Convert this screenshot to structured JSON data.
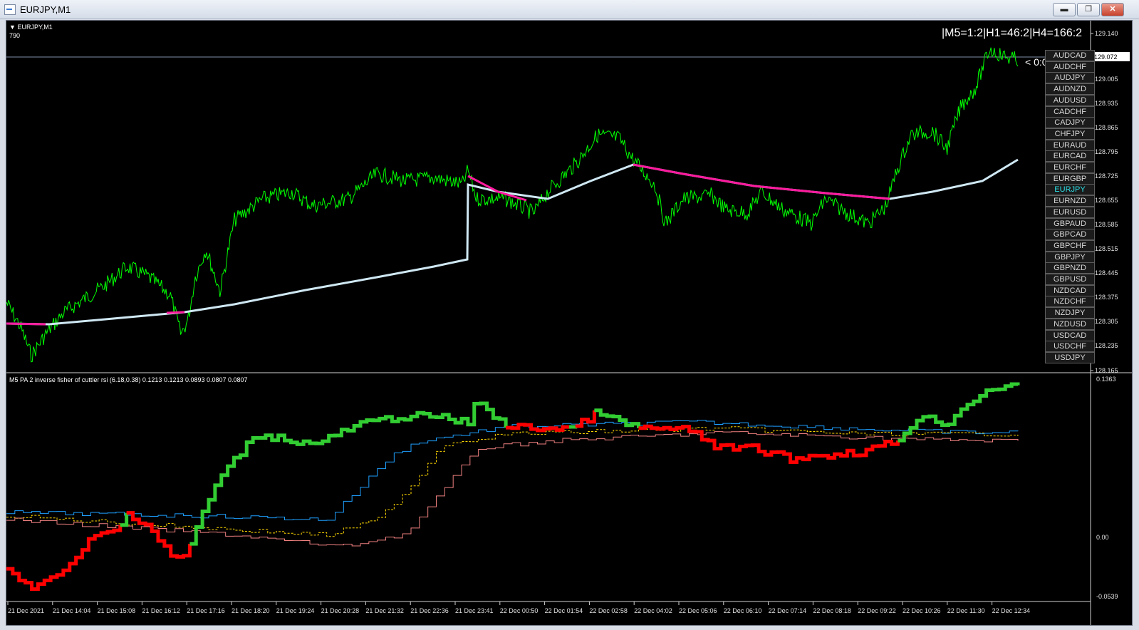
{
  "window": {
    "title": "EURJPY,M1",
    "minimize_glyph": "▬",
    "restore_glyph": "❐",
    "close_glyph": "✕"
  },
  "chart": {
    "symbol_label": "EURJPY,M1",
    "sub_label": "790",
    "status_text": "|M5=1:2|H1=46:2|H4=166:2",
    "marker_text": "< 0:02",
    "current_price": "129.072",
    "price_ticks": [
      "129.140",
      "129.005",
      "128.935",
      "128.865",
      "128.795",
      "128.725",
      "128.655",
      "128.585",
      "128.515",
      "128.445",
      "128.375",
      "128.305",
      "128.235",
      "128.165"
    ],
    "price_color": "#00ff00",
    "ma_color_up": "#cfe8f3",
    "ma_color_down": "#ff1a9e"
  },
  "indicator": {
    "label": "M5 PA 2 inverse fisher of cuttler rsi (6.18,0.38) 0.1213 0.1213 0.0893 0.0807 0.0807",
    "ticks": [
      "0.1363",
      "0.00",
      "-0.0539"
    ],
    "bull_color": "#32cd32",
    "bear_color": "#ff0000",
    "line_colors": [
      "#1ea0ff",
      "#ffd700",
      "#f08080"
    ]
  },
  "time_axis": [
    "21 Dec 2021",
    "21 Dec 14:04",
    "21 Dec 15:08",
    "21 Dec 16:12",
    "21 Dec 17:16",
    "21 Dec 18:20",
    "21 Dec 19:24",
    "21 Dec 20:28",
    "21 Dec 21:32",
    "21 Dec 22:36",
    "21 Dec 23:41",
    "22 Dec 00:50",
    "22 Dec 01:54",
    "22 Dec 02:58",
    "22 Dec 04:02",
    "22 Dec 05:06",
    "22 Dec 06:10",
    "22 Dec 07:14",
    "22 Dec 08:18",
    "22 Dec 09:22",
    "22 Dec 10:26",
    "22 Dec 11:30",
    "22 Dec 12:34"
  ],
  "pair_buttons": [
    "AUDCAD",
    "AUDCHF",
    "AUDJPY",
    "AUDNZD",
    "AUDUSD",
    "CADCHF",
    "CADJPY",
    "CHFJPY",
    "EURAUD",
    "EURCAD",
    "EURCHF",
    "EURGBP",
    "EURJPY",
    "EURNZD",
    "EURUSD",
    "GBPAUD",
    "GBPCAD",
    "GBPCHF",
    "GBPJPY",
    "GBPNZD",
    "GBPUSD",
    "NZDCAD",
    "NZDCHF",
    "NZDJPY",
    "NZDUSD",
    "USDCAD",
    "USDCHF",
    "USDJPY"
  ],
  "active_pair": "EURJPY"
}
